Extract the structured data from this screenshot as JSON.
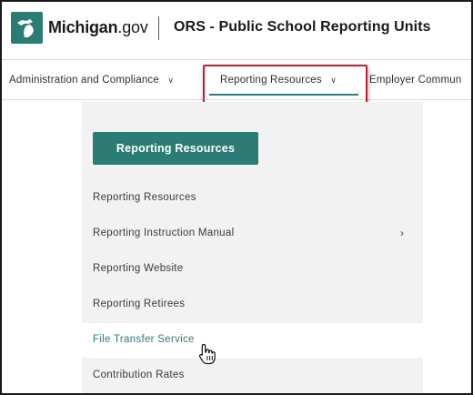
{
  "header": {
    "brand_name": "Michigan",
    "brand_suffix": ".gov",
    "site_title": "ORS - Public School Reporting Units"
  },
  "nav": {
    "items": [
      {
        "label": "Administration and Compliance"
      },
      {
        "label": "Reporting Resources"
      },
      {
        "label": "Employer Commun"
      }
    ],
    "chevron": "∨"
  },
  "dropdown": {
    "button_label": "Reporting Resources",
    "items": [
      {
        "label": "Reporting Resources"
      },
      {
        "label": "Reporting Instruction Manual"
      },
      {
        "label": "Reporting Website"
      },
      {
        "label": "Reporting Retirees"
      },
      {
        "label": "File Transfer Service"
      },
      {
        "label": "Contribution Rates"
      }
    ],
    "submenu_arrow": "›"
  },
  "colors": {
    "accent": "#2b7c74",
    "highlight": "#c2202f",
    "panel_bg": "#f2f2f2"
  }
}
